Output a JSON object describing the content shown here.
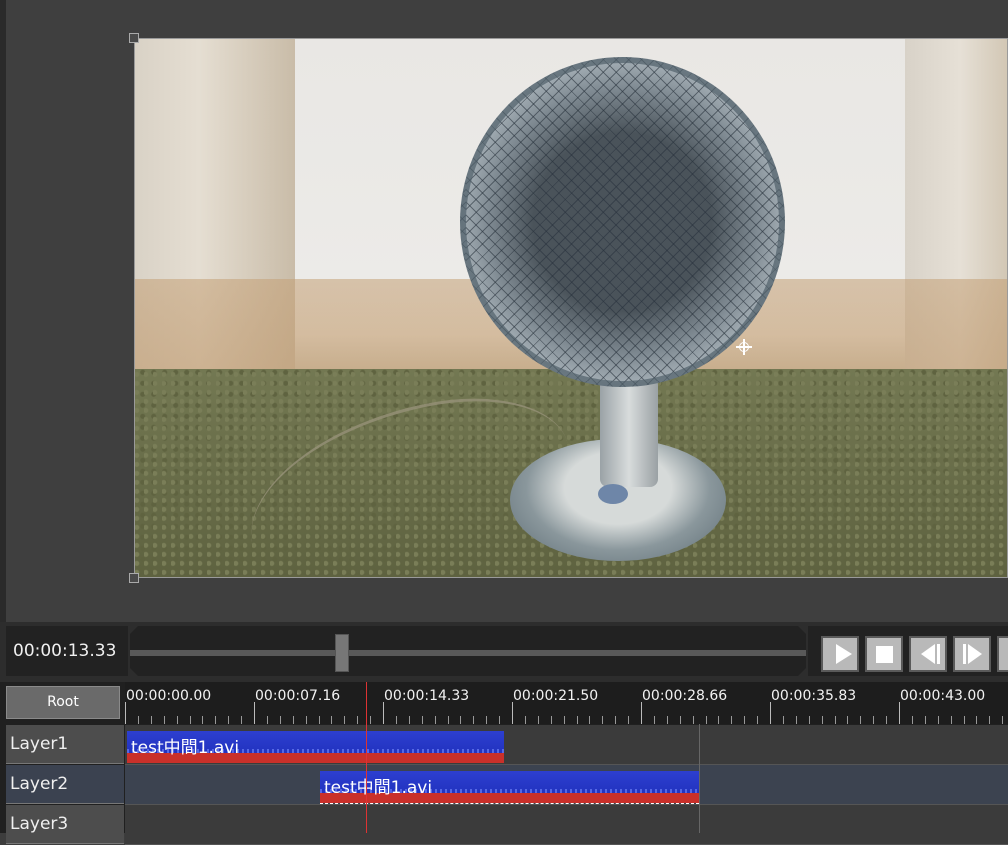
{
  "preview": {
    "image_subject": "desk fan in front of curtains on green carpet"
  },
  "transport": {
    "current_time": "00:00:13.33",
    "seek_position_fraction": 0.31,
    "buttons": [
      {
        "name": "play-button",
        "icon": "play-icon"
      },
      {
        "name": "stop-button",
        "icon": "stop-icon"
      },
      {
        "name": "prev-frame-button",
        "icon": "step-back-icon"
      },
      {
        "name": "next-frame-button",
        "icon": "step-forward-icon"
      }
    ]
  },
  "timeline": {
    "root_label": "Root",
    "ruler_labels": [
      "00:00:00.00",
      "00:00:07.16",
      "00:00:14.33",
      "00:00:21.50",
      "00:00:28.66",
      "00:00:35.83",
      "00:00:43.00"
    ],
    "layers": [
      {
        "name": "Layer1",
        "clip": {
          "label": "test中間1.avi",
          "start": "00:00:00.00",
          "selected": false
        }
      },
      {
        "name": "Layer2",
        "clip": {
          "label": "test中間1.avi",
          "start": "00:00:10.77",
          "selected": true
        }
      },
      {
        "name": "Layer3"
      }
    ],
    "playhead_time": "00:00:13.33"
  },
  "colors": {
    "clip_video": "#2233c0",
    "clip_audio": "#c9302a",
    "playhead": "#d33333"
  }
}
